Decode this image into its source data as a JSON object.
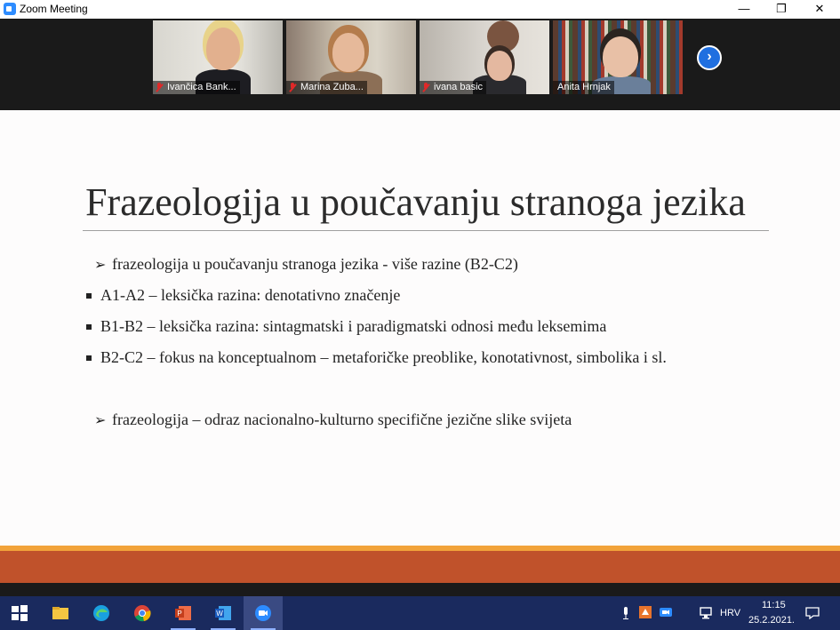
{
  "window": {
    "title": "Zoom Meeting",
    "minimize": "—",
    "restore": "❐",
    "close": "✕"
  },
  "participants": [
    {
      "name": "Ivančica Bank...",
      "muted": true,
      "active": false
    },
    {
      "name": "Marina Zuba...",
      "muted": true,
      "active": false
    },
    {
      "name": "ivana basic",
      "muted": true,
      "active": false
    },
    {
      "name": "Anita Hrnjak",
      "muted": false,
      "active": true
    }
  ],
  "next_button": "›",
  "slide": {
    "title": "Frazeologija u poučavanju stranoga jezika",
    "bullets": [
      {
        "marker": "➢",
        "text": "frazeologija u poučavanju stranoga jezika - više razine (B2-C2)"
      },
      {
        "marker": "square",
        "text": "A1-A2 – leksička razina: denotativno značenje"
      },
      {
        "marker": "square",
        "text": "B1-B2 – leksička razina: sintagmatski i paradigmatski odnosi među leksemima"
      },
      {
        "marker": "square",
        "text": "B2-C2 – fokus na konceptualnom – metaforičke preoblike, konotativnost, simbolika i sl."
      },
      {
        "marker": "➢",
        "text": "frazeologija – odraz nacionalno-kulturno specifične jezične slike svijeta"
      }
    ]
  },
  "taskbar": {
    "apps": [
      "windows-start",
      "file-explorer",
      "edge",
      "chrome",
      "powerpoint",
      "word",
      "zoom"
    ],
    "language": "HRV",
    "time": "11:15",
    "date": "25.2.2021."
  },
  "colors": {
    "slide_band": "#c0522b",
    "slide_band_top": "#f2a33a",
    "taskbar": "#1a2a5e",
    "active_speaker": "#9bd33b"
  }
}
